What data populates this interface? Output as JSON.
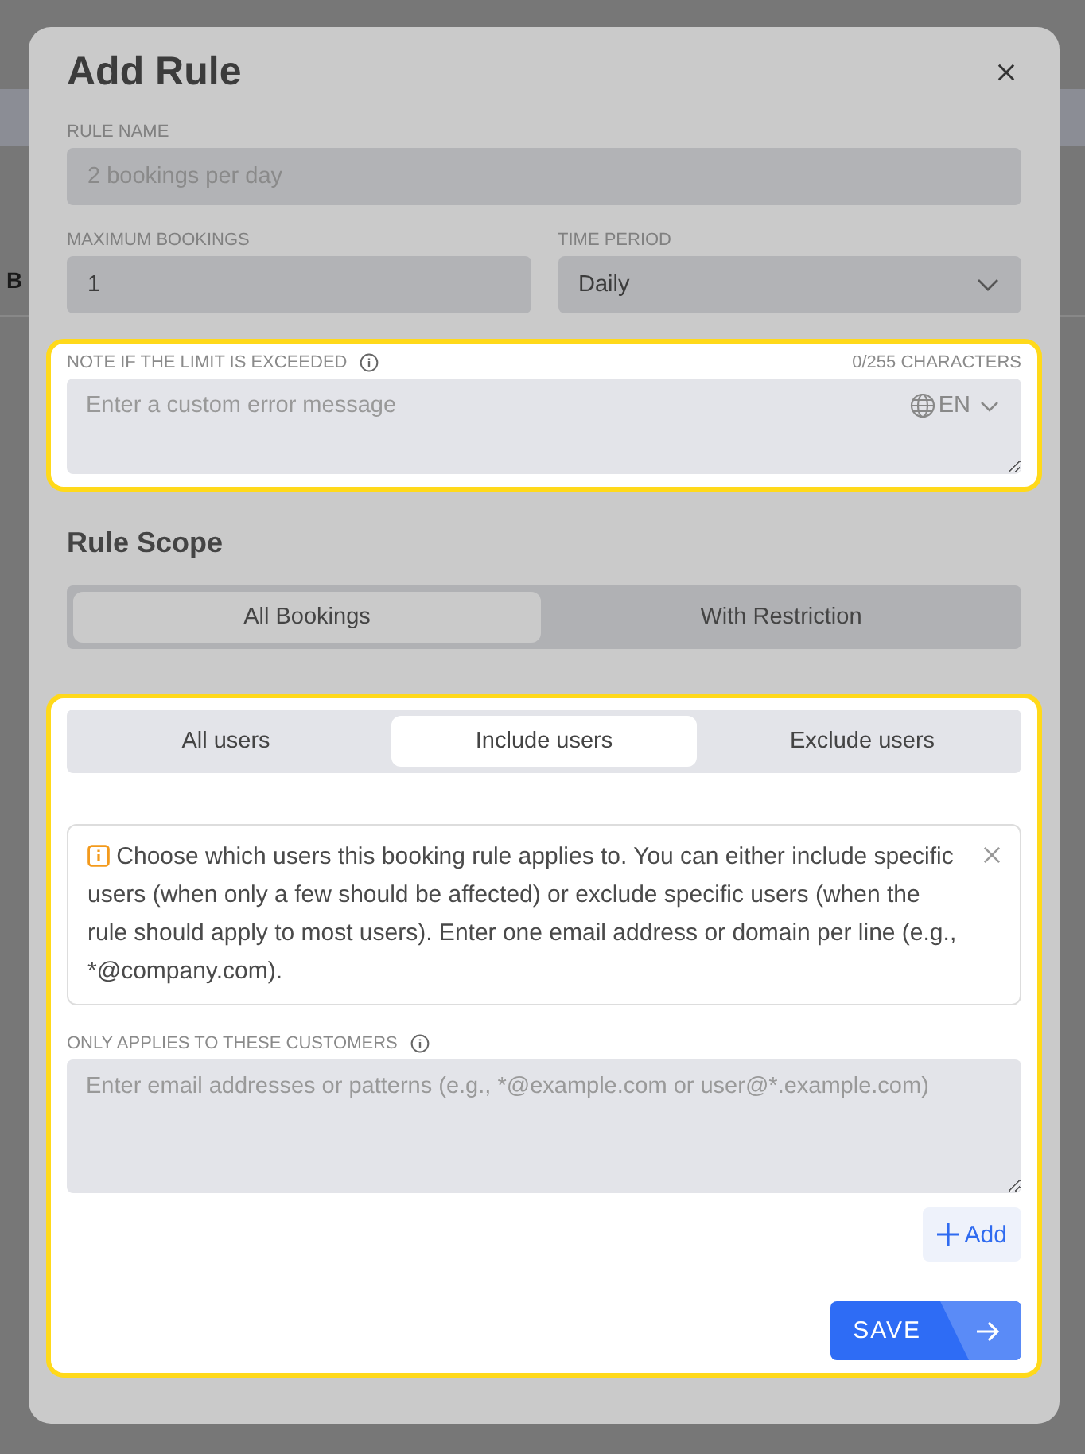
{
  "background": {
    "text_fragment": "B"
  },
  "dialog": {
    "title": "Add Rule"
  },
  "rule_name": {
    "label": "RULE NAME",
    "placeholder": "2 bookings per day"
  },
  "maximum_bookings": {
    "label": "MAXIMUM BOOKINGS",
    "value": "1"
  },
  "time_period": {
    "label": "TIME PERIOD",
    "value": "Daily"
  },
  "note": {
    "highlighted": true,
    "label": "NOTE IF THE LIMIT IS EXCEEDED",
    "counter": "0/255 CHARACTERS",
    "placeholder": "Enter a custom error message",
    "language": "EN"
  },
  "rule_scope": {
    "title": "Rule Scope",
    "options": [
      {
        "label": "All Bookings",
        "selected": true
      },
      {
        "label": "With Restriction",
        "selected": false
      }
    ]
  },
  "users": {
    "highlighted": true,
    "tabs": [
      {
        "label": "All users",
        "selected": false
      },
      {
        "label": "Include users",
        "selected": true
      },
      {
        "label": "Exclude users",
        "selected": false
      }
    ],
    "info": "Choose which users this booking rule applies to. You can either include specific users (when only a few should be affected) or exclude specific users (when the rule should apply to most users). Enter one email address or domain per line (e.g., *@company.com).",
    "label": "ONLY APPLIES TO THESE CUSTOMERS",
    "placeholder": "Enter email addresses or patterns (e.g., *@example.com or user@*.example.com)",
    "add_button": "Add",
    "save_button": "SAVE"
  }
}
